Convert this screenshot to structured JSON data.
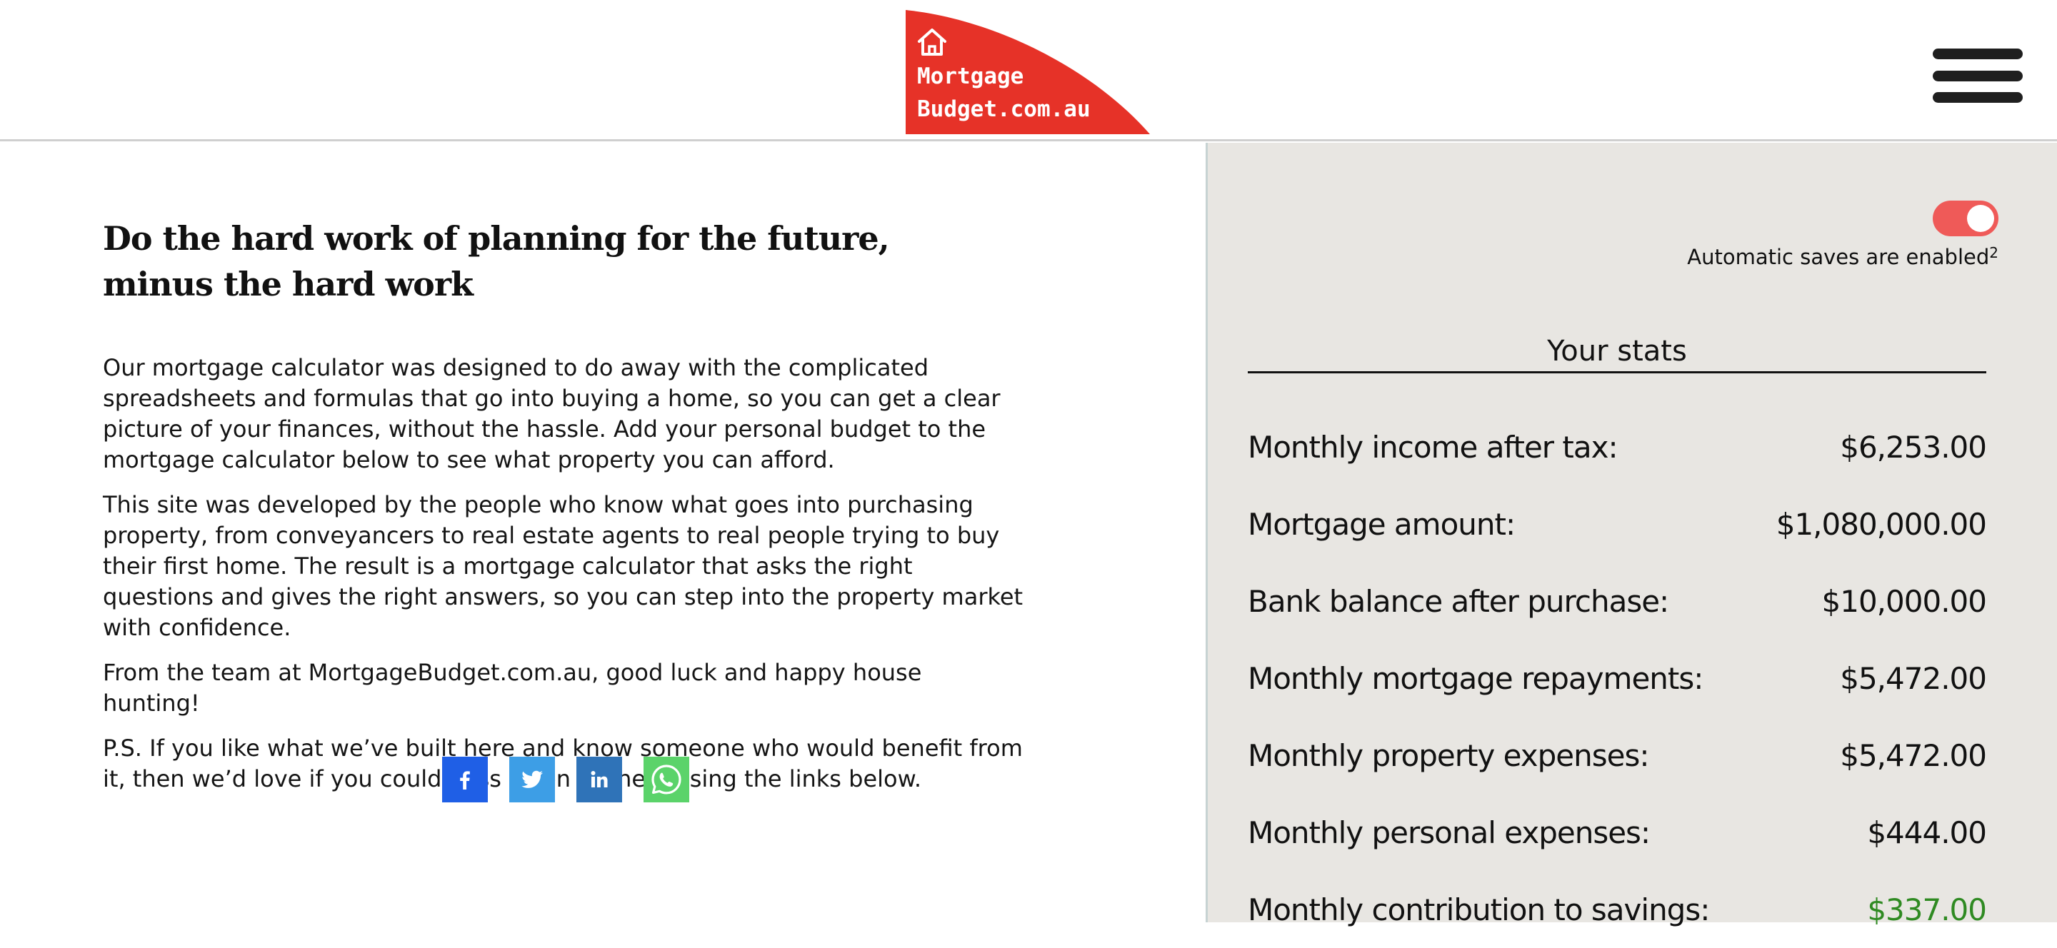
{
  "header": {
    "logo": {
      "line1": "Mortgage",
      "line2": "Budget.com.au",
      "icon": "house-icon",
      "color": "#e63228"
    },
    "menu_icon": "hamburger-menu-icon"
  },
  "intro": {
    "headline_line1": "Do the hard work of planning for the future,",
    "headline_line2": "minus the hard work",
    "paragraphs": [
      "Our mortgage calculator was designed to do away with the complicated spreadsheets and formulas that go into buying a home, so you can get a clear picture of your finances, without the hassle. Add your personal budget to the mortgage calculator below to see what property you can afford.",
      "This site was developed by the people who know what goes into purchasing property, from conveyancers to real estate agents to real people trying to buy their first home. The result is a mortgage calculator that asks the right questions and gives the right answers, so you can step into the property market with confidence.",
      "From the team at MortgageBudget.com.au, good luck and happy house hunting!",
      "P.S. If you like what we’ve built here and know someone who would benefit from it, then we’d love if you could pass us on to them using the links below."
    ]
  },
  "social": {
    "facebook_icon": "facebook-icon",
    "twitter_icon": "twitter-icon",
    "linkedin_icon": "linkedin-icon",
    "whatsapp_icon": "whatsapp-icon",
    "colors": {
      "facebook": "#1f5fe6",
      "twitter": "#3d9ee6",
      "linkedin": "#2f73b8",
      "whatsapp": "#5bd36a"
    }
  },
  "panel": {
    "autosave_enabled": true,
    "autosave_label": "Automatic saves are enabled",
    "autosave_footnote": "2",
    "toggle_color": "#ef5a58",
    "stats_title": "Your stats",
    "stats": [
      {
        "label": "Monthly income after tax:",
        "value": "$6,253.00"
      },
      {
        "label": "Mortgage amount:",
        "value": "$1,080,000.00"
      },
      {
        "label": "Bank balance after purchase:",
        "value": "$10,000.00"
      },
      {
        "label": "Monthly mortgage repayments:",
        "value": "$5,472.00"
      },
      {
        "label": "Monthly property expenses:",
        "value": "$5,472.00"
      },
      {
        "label": "Monthly personal expenses:",
        "value": "$444.00"
      },
      {
        "label": "Monthly contribution to savings:",
        "value": "$337.00",
        "positive_color": "#2f8a22"
      }
    ]
  }
}
